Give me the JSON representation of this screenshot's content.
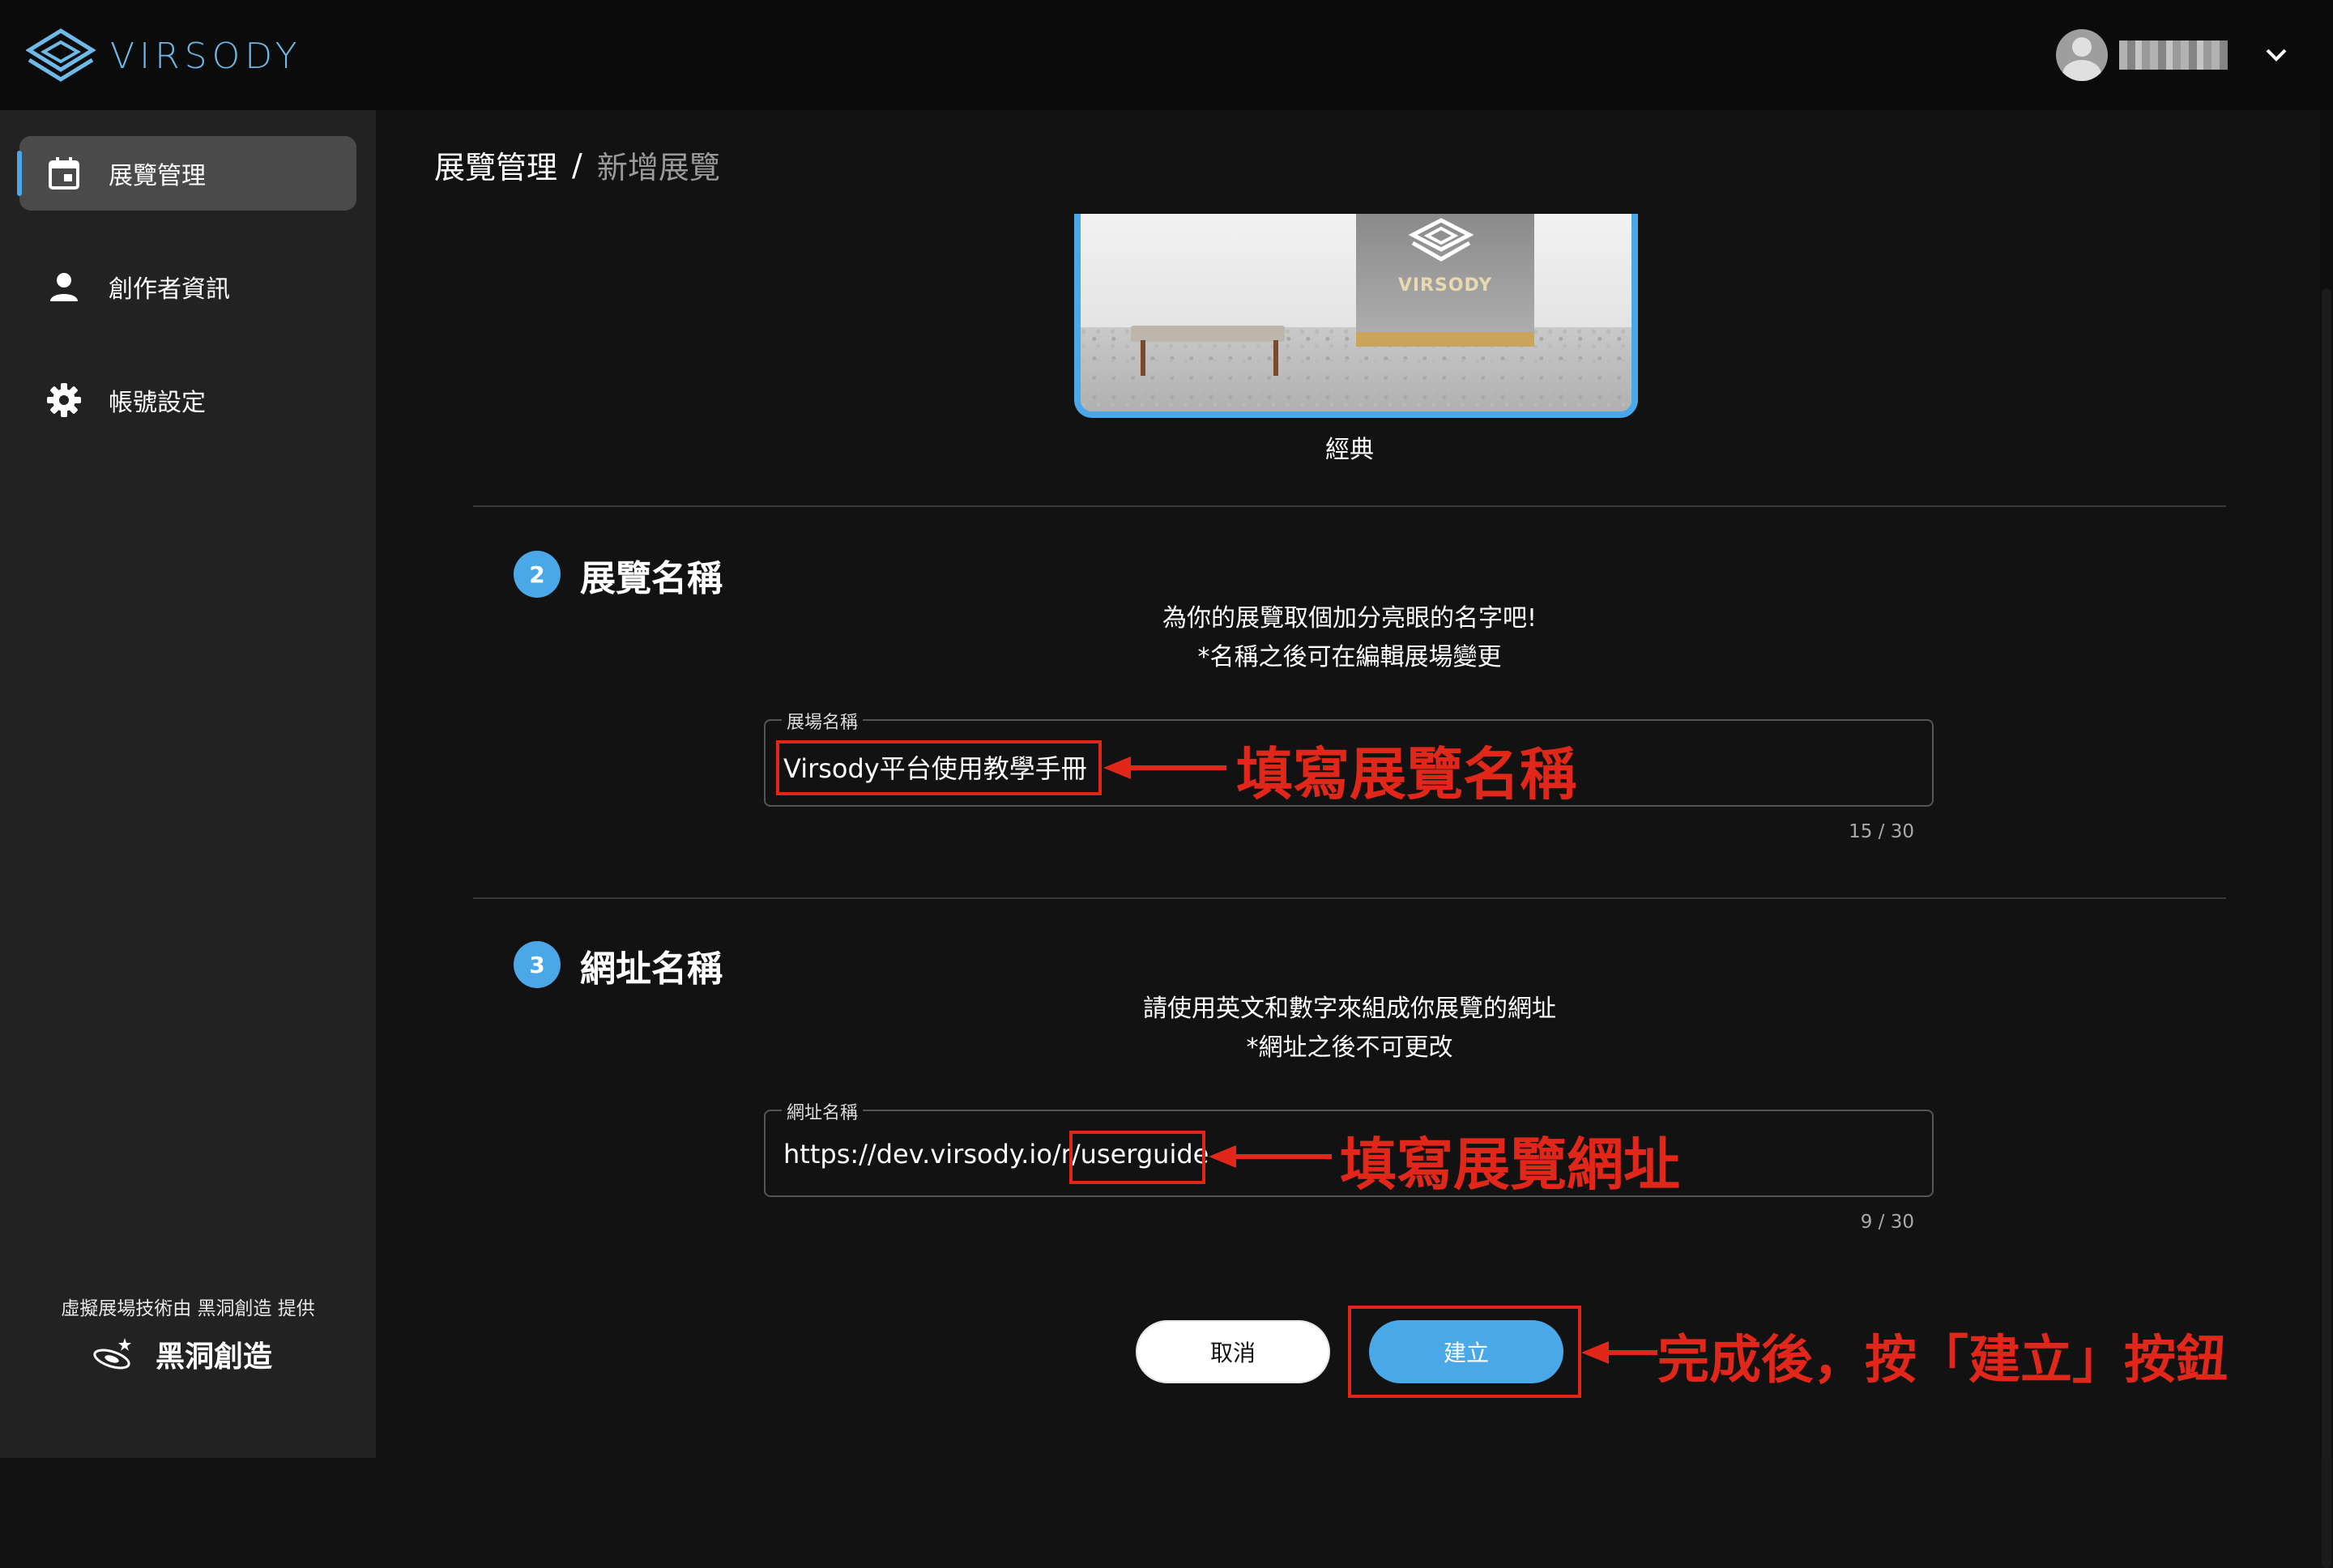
{
  "header": {
    "logo_text": "VIRSODY",
    "accent_color": "#4aa8e8"
  },
  "sidebar": {
    "items": [
      {
        "label": "展覽管理",
        "icon": "calendar-icon",
        "active": true
      },
      {
        "label": "創作者資訊",
        "icon": "person-icon",
        "active": false
      },
      {
        "label": "帳號設定",
        "icon": "gear-icon",
        "active": false
      }
    ],
    "powered_by": "虛擬展場技術由 黑洞創造 提供",
    "brand_name": "黑洞創造"
  },
  "breadcrumb": {
    "current": "展覽管理",
    "separator": "/",
    "last": "新增展覽"
  },
  "template": {
    "label": "經典",
    "preview_sign": "VIRSODY"
  },
  "step2": {
    "number": "2",
    "title": "展覽名稱",
    "desc_line1": "為你的展覽取個加分亮眼的名字吧!",
    "desc_line2": "*名稱之後可在編輯展場變更",
    "field_label": "展場名稱",
    "field_value": "Virsody平台使用教學手冊",
    "counter": "15 / 30",
    "annotation": "填寫展覽名稱"
  },
  "step3": {
    "number": "3",
    "title": "網址名稱",
    "desc_line1": "請使用英文和數字來組成你展覽的網址",
    "desc_line2": "*網址之後不可更改",
    "field_label": "網址名稱",
    "url_prefix": "https://dev.virsody.io/r/",
    "url_slug": "userguide",
    "counter": "9 / 30",
    "annotation": "填寫展覽網址"
  },
  "actions": {
    "cancel_label": "取消",
    "create_label": "建立",
    "annotation": "完成後，按「建立」按鈕"
  },
  "annotation_color": "#e0271a"
}
